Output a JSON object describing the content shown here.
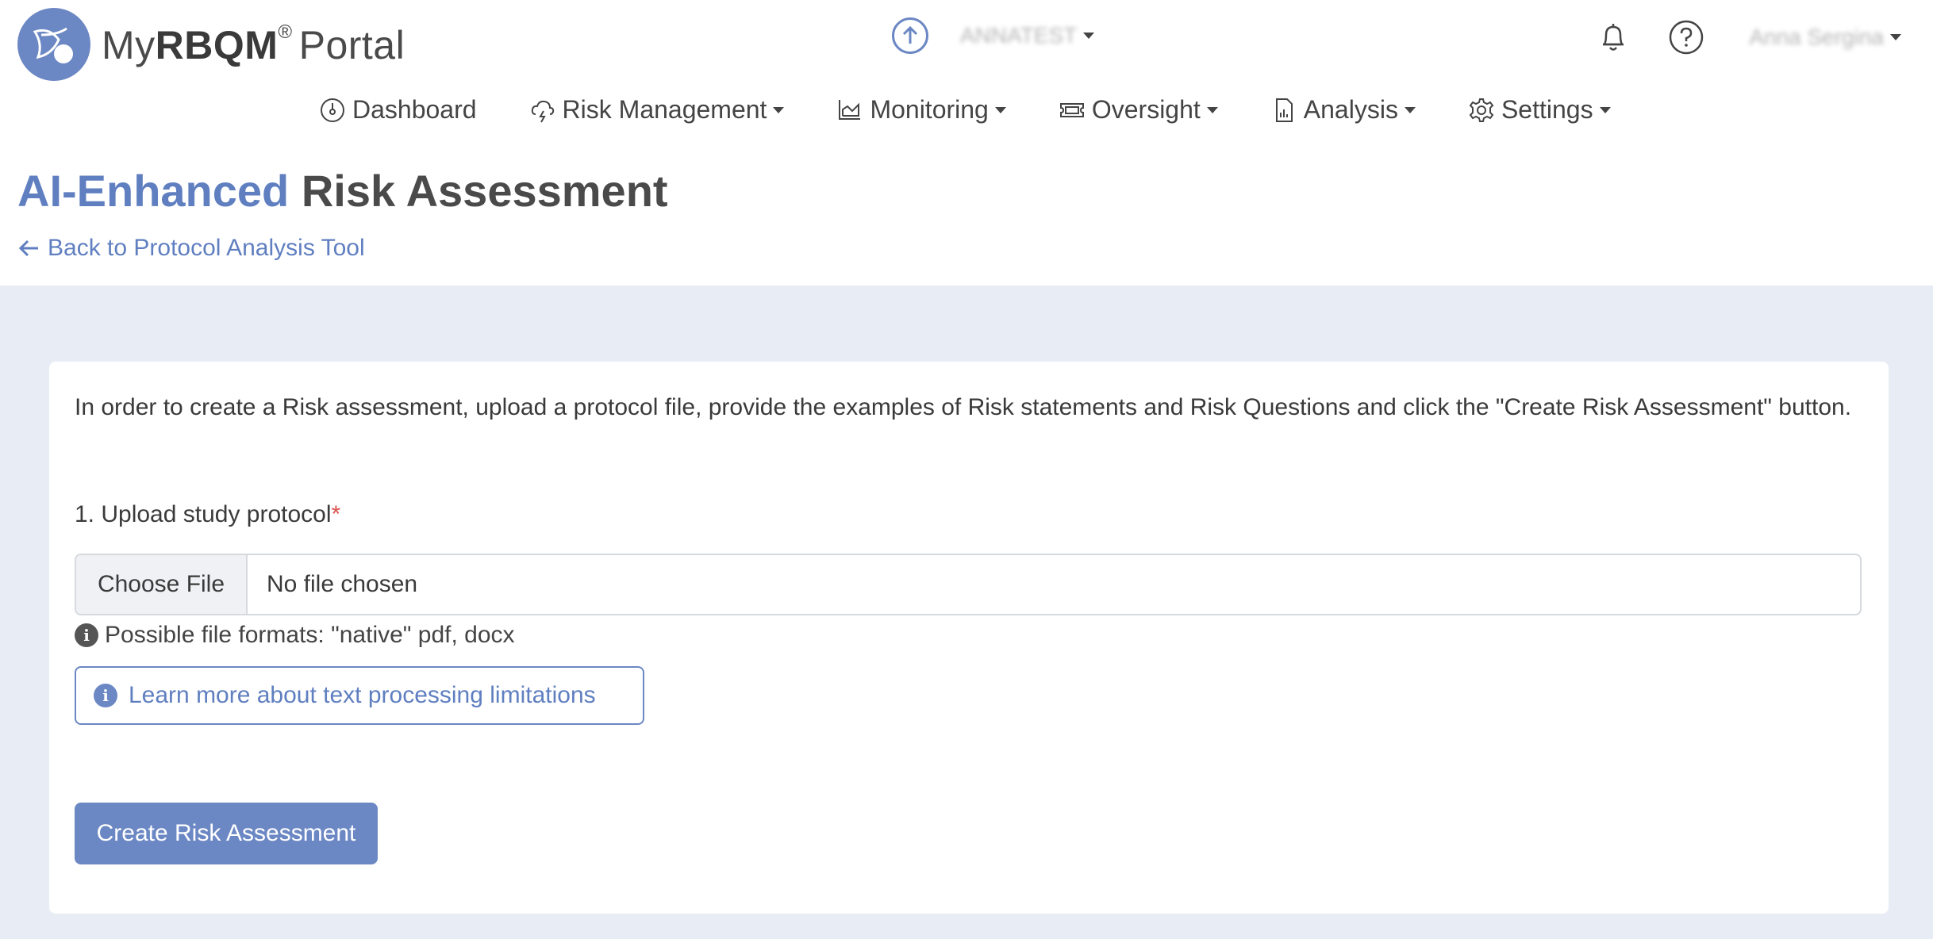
{
  "brand": {
    "name_prefix": "My",
    "name_bold": "RBQM",
    "registered": "®",
    "name_suffix": "Portal",
    "logo_color": "#6b87c4"
  },
  "header": {
    "study_selector": {
      "label": "ANNATEST",
      "icon": "upload-circle-icon"
    },
    "notifications_icon": "bell-icon",
    "help_icon": "question-circle-icon",
    "user_menu": {
      "label": "Anna Sergina"
    }
  },
  "nav": {
    "items": [
      {
        "label": "Dashboard",
        "icon": "dashboard-gauge-icon",
        "has_dropdown": false
      },
      {
        "label": "Risk Management",
        "icon": "cloud-lightning-icon",
        "has_dropdown": true
      },
      {
        "label": "Monitoring",
        "icon": "area-chart-icon",
        "has_dropdown": true
      },
      {
        "label": "Oversight",
        "icon": "ticket-icon",
        "has_dropdown": true
      },
      {
        "label": "Analysis",
        "icon": "file-chart-icon",
        "has_dropdown": true
      },
      {
        "label": "Settings",
        "icon": "gear-icon",
        "has_dropdown": true
      }
    ]
  },
  "page": {
    "title_accent": "AI-Enhanced",
    "title_rest": "Risk Assessment",
    "back_link": "Back to Protocol Analysis Tool"
  },
  "form": {
    "intro": "In order to create a Risk assessment, upload a protocol file, provide the examples of Risk statements and Risk Questions and click the \"Create Risk Assessment\" button.",
    "step_label": "1. Upload study protocol",
    "required_mark": "*",
    "file_input": {
      "button_label": "Choose File",
      "status": "No file chosen"
    },
    "formats_hint": "Possible file formats: \"native\" pdf, docx",
    "learn_more": "Learn more about text processing limitations",
    "submit_label": "Create Risk Assessment"
  },
  "colors": {
    "accent": "#5f7fc0",
    "button": "#6b87c4",
    "page_background": "#e8ecf5",
    "required": "#d9534f"
  }
}
